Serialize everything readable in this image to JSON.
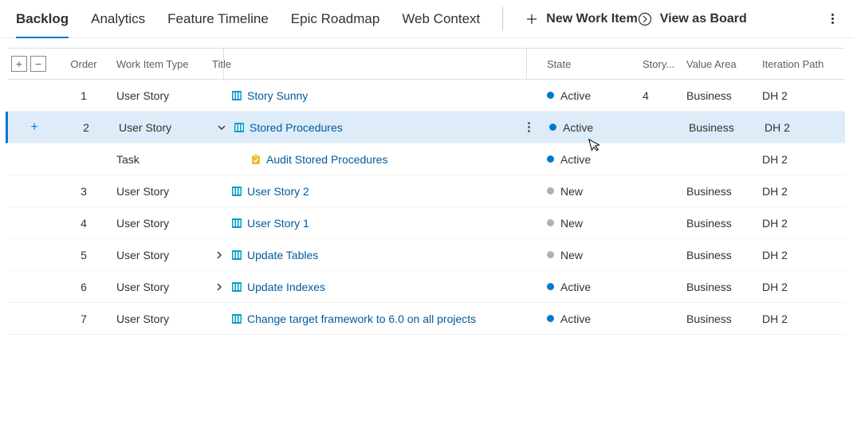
{
  "tabs": [
    "Backlog",
    "Analytics",
    "Feature Timeline",
    "Epic Roadmap",
    "Web Context"
  ],
  "active_tab_index": 0,
  "actions": {
    "new_item": "New Work Item",
    "view_board": "View as Board"
  },
  "columns": {
    "order": "Order",
    "type": "Work Item Type",
    "title": "Title",
    "state": "State",
    "story": "Story...",
    "value_area": "Value Area",
    "iteration": "Iteration Path"
  },
  "colors": {
    "active": "#007acc",
    "new": "#b2b0ad",
    "user_story_icon": "#009ccc",
    "task_icon": "#f2b926"
  },
  "rows": [
    {
      "order": "1",
      "type": "User Story",
      "title": "Story Sunny",
      "icon": "story",
      "expander": "none",
      "indent": 0,
      "state": "Active",
      "state_color": "active",
      "story_points": "4",
      "value_area": "Business",
      "iteration": "DH 2",
      "selected": false
    },
    {
      "order": "2",
      "type": "User Story",
      "title": "Stored Procedures",
      "icon": "story",
      "expander": "expanded",
      "indent": 0,
      "state": "Active",
      "state_color": "active",
      "story_points": "",
      "value_area": "Business",
      "iteration": "DH 2",
      "selected": true
    },
    {
      "order": "",
      "type": "Task",
      "title": "Audit Stored Procedures",
      "icon": "task",
      "expander": "none",
      "indent": 1,
      "state": "Active",
      "state_color": "active",
      "story_points": "",
      "value_area": "",
      "iteration": "DH 2",
      "selected": false
    },
    {
      "order": "3",
      "type": "User Story",
      "title": "User Story 2",
      "icon": "story",
      "expander": "none",
      "indent": 0,
      "state": "New",
      "state_color": "new",
      "story_points": "",
      "value_area": "Business",
      "iteration": "DH 2",
      "selected": false
    },
    {
      "order": "4",
      "type": "User Story",
      "title": "User Story 1",
      "icon": "story",
      "expander": "none",
      "indent": 0,
      "state": "New",
      "state_color": "new",
      "story_points": "",
      "value_area": "Business",
      "iteration": "DH 2",
      "selected": false
    },
    {
      "order": "5",
      "type": "User Story",
      "title": "Update Tables",
      "icon": "story",
      "expander": "collapsed",
      "indent": 0,
      "state": "New",
      "state_color": "new",
      "story_points": "",
      "value_area": "Business",
      "iteration": "DH 2",
      "selected": false
    },
    {
      "order": "6",
      "type": "User Story",
      "title": "Update Indexes",
      "icon": "story",
      "expander": "collapsed",
      "indent": 0,
      "state": "Active",
      "state_color": "active",
      "story_points": "",
      "value_area": "Business",
      "iteration": "DH 2",
      "selected": false
    },
    {
      "order": "7",
      "type": "User Story",
      "title": "Change target framework to 6.0 on all projects",
      "icon": "story",
      "expander": "none",
      "indent": 0,
      "state": "Active",
      "state_color": "active",
      "story_points": "",
      "value_area": "Business",
      "iteration": "DH 2",
      "selected": false
    }
  ]
}
